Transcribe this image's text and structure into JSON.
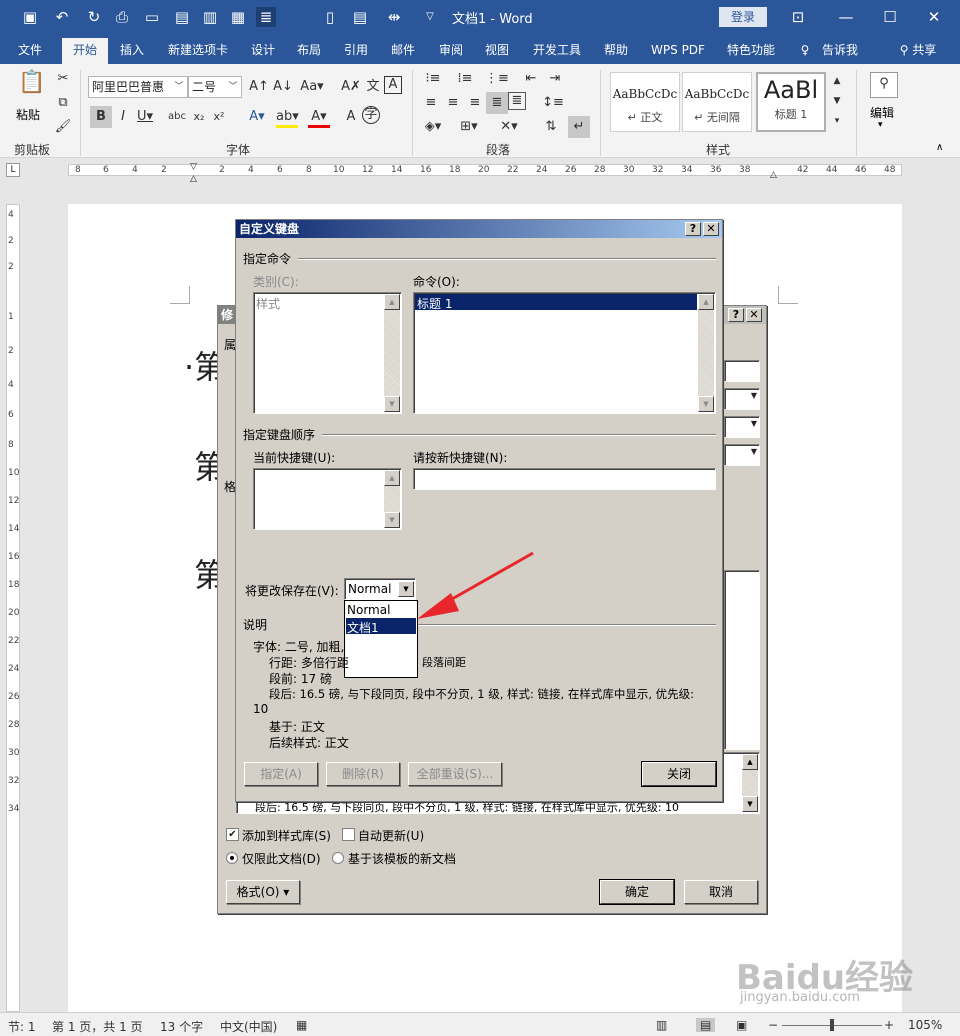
{
  "titlebar": {
    "title": "文档1 - Word",
    "login": "登录",
    "icons": [
      "save-icon",
      "undo-icon",
      "redo-icon",
      "print-preview-icon",
      "new-doc-icon",
      "open-icon",
      "paste-icon",
      "format-icon",
      "list-icon"
    ]
  },
  "tabs": [
    "文件",
    "开始",
    "插入",
    "新建选项卡",
    "设计",
    "布局",
    "引用",
    "邮件",
    "审阅",
    "视图",
    "开发工具",
    "帮助",
    "WPS PDF",
    "特色功能",
    "告诉我",
    "共享"
  ],
  "ribbon": {
    "paste_label": "粘贴",
    "clipboard_label": "剪贴板",
    "font_name": "阿里巴巴普惠",
    "font_size": "二号",
    "font_group_label": "字体",
    "paragraph_label": "段落",
    "styles_label": "样式",
    "edit_label": "编辑",
    "styles": [
      {
        "preview": "AaBbCcDc",
        "name": "↵ 正文"
      },
      {
        "preview": "AaBbCcDc",
        "name": "↵ 无间隔"
      },
      {
        "preview": "AaBl",
        "name": "标题 1"
      }
    ]
  },
  "ruler": {
    "numbers": [
      "8",
      "6",
      "4",
      "2",
      "2",
      "4",
      "6",
      "8",
      "10",
      "12",
      "14",
      "16",
      "18",
      "20",
      "22",
      "24",
      "26",
      "28",
      "30",
      "32",
      "34",
      "36",
      "38",
      "42",
      "44",
      "46",
      "48"
    ],
    "vnumbers": [
      "4",
      "2",
      "2",
      "1",
      "2",
      "4",
      "6",
      "8",
      "10",
      "12",
      "14",
      "16",
      "18",
      "20",
      "22",
      "24",
      "26",
      "28",
      "30",
      "32",
      "34"
    ]
  },
  "document": {
    "chars": [
      "·第",
      "第",
      "第"
    ]
  },
  "back_dialog": {
    "title": "修",
    "row_label": "属",
    "format_label": "格",
    "preview_text": "段后: 16.5 磅, 与下段同页, 段中不分页, 1 级, 样式: 链接, 在样式库中显示, 优先级: 10",
    "add_to_gallery": "添加到样式库(S)",
    "auto_update": "自动更新(U)",
    "only_this_doc": "仅限此文档(D)",
    "new_docs_template": "基于该模板的新文档",
    "format_button": "格式(O) ▾",
    "ok": "确定",
    "cancel": "取消"
  },
  "kb_dialog": {
    "title": "自定义键盘",
    "specify_command": "指定命令",
    "category_label": "类别(C):",
    "category_item": "样式",
    "command_label": "命令(O):",
    "command_item": "标题 1",
    "key_sequence": "指定键盘顺序",
    "current_keys_label": "当前快捷键(U):",
    "new_key_label": "请按新快捷键(N):",
    "save_in_label": "将更改保存在(V):",
    "save_in_value": "Normal",
    "dropdown_options": [
      "Normal",
      "文档1"
    ],
    "desc_label": "说明",
    "desc_lines": [
      "字体: 二号, 加粗,",
      "行距: 多倍行距",
      "段落间距",
      "段前: 17 磅",
      "段后: 16.5 磅, 与下段同页, 段中不分页, 1 级, 样式: 链接, 在样式库中显示, 优先级:",
      "10",
      "基于: 正文",
      "后续样式: 正文"
    ],
    "assign": "指定(A)",
    "remove": "删除(R)",
    "reset_all": "全部重设(S)...",
    "close": "关闭",
    "help": "?",
    "x": "✕"
  },
  "status": {
    "section": "节: 1",
    "page": "第 1 页，共 1 页",
    "words": "13 个字",
    "lang": "中文(中国)",
    "zoom": "105%"
  },
  "watermark": "Baidu经验",
  "watermark_sub": "jingyan.baidu.com",
  "colors": {
    "brand": "#2b579a",
    "dialog": "#d4d0c8",
    "select": "#0a246a",
    "arrow": "#e8272d"
  }
}
